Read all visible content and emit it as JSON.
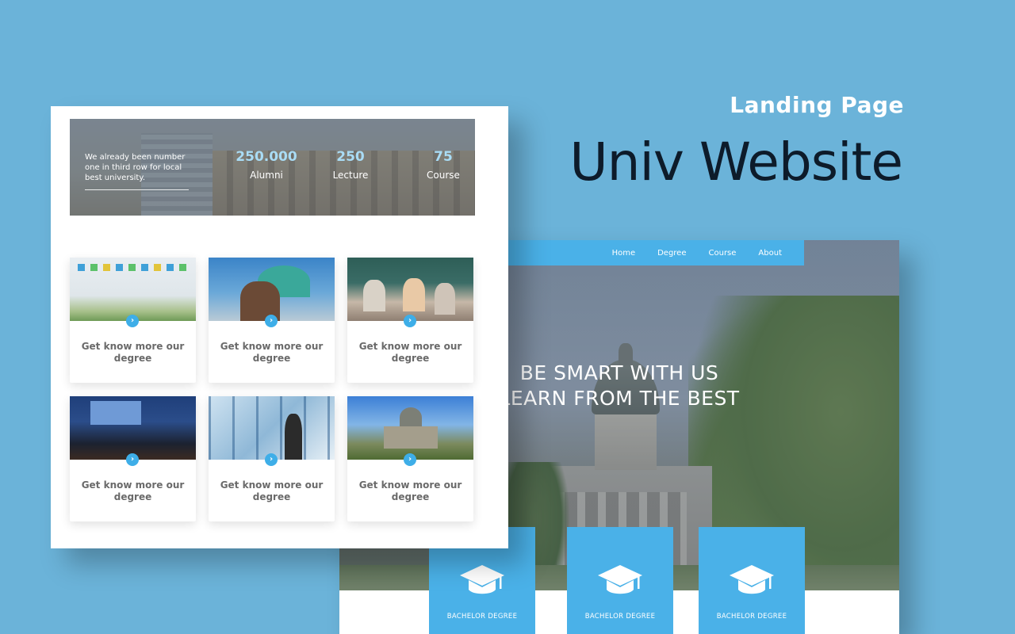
{
  "heading": {
    "eyebrow": "Landing Page",
    "title": "Univ Website"
  },
  "back_page": {
    "nav": [
      {
        "label": "Home"
      },
      {
        "label": "Degree"
      },
      {
        "label": "Course"
      },
      {
        "label": "About"
      }
    ],
    "hero": {
      "line1": "BE SMART WITH US",
      "line2": "LEARN FROM THE BEST"
    },
    "degree_cards": [
      {
        "label": "BACHELOR DEGREE",
        "icon": "graduation-cap-icon"
      },
      {
        "label": "BACHELOR DEGREE",
        "icon": "graduation-cap-icon"
      },
      {
        "label": "BACHELOR DEGREE",
        "icon": "graduation-cap-icon"
      }
    ]
  },
  "front_page": {
    "stats": {
      "intro": "We already been number one in third row for local best university.",
      "items": [
        {
          "value": "250.000",
          "label": "Alumni"
        },
        {
          "value": "250",
          "label": "Lecture"
        },
        {
          "value": "75",
          "label": "Course"
        }
      ]
    },
    "cards": [
      {
        "text": "Get know more our degree",
        "icon": "chevron-right-icon"
      },
      {
        "text": "Get know more our degree",
        "icon": "chevron-right-icon"
      },
      {
        "text": "Get know more our degree",
        "icon": "chevron-right-icon"
      },
      {
        "text": "Get know more our degree",
        "icon": "chevron-right-icon"
      },
      {
        "text": "Get know more our degree",
        "icon": "chevron-right-icon"
      },
      {
        "text": "Get know more our degree",
        "icon": "chevron-right-icon"
      }
    ]
  },
  "colors": {
    "background": "#6bb3d9",
    "accent": "#4ab1e8",
    "title_dark": "#0d1b2a",
    "card_text": "#6a6a6a"
  }
}
